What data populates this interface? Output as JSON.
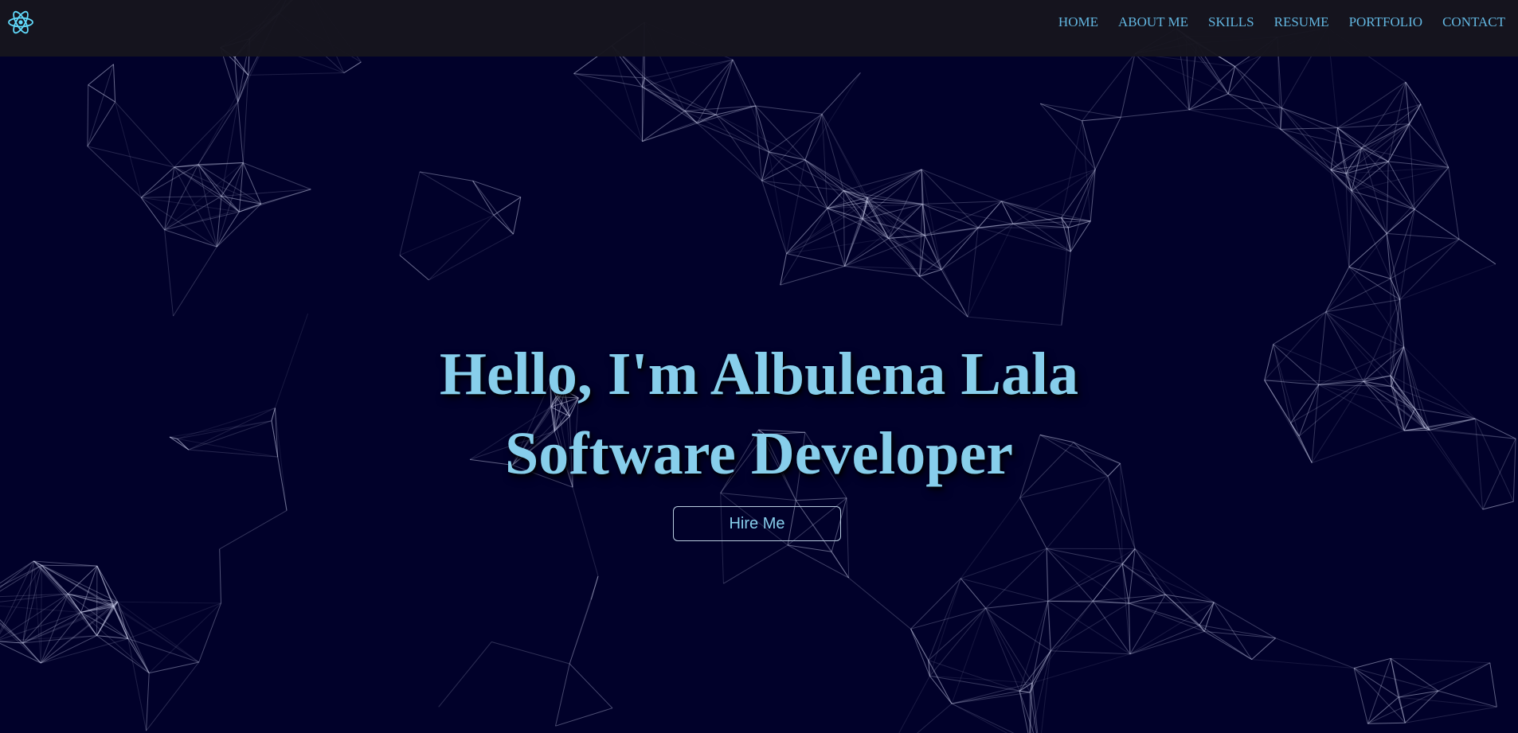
{
  "nav": {
    "logo_icon": "atom-icon",
    "items": [
      {
        "label": "HOME"
      },
      {
        "label": "ABOUT ME"
      },
      {
        "label": "SKILLS"
      },
      {
        "label": "RESUME"
      },
      {
        "label": "PORTFOLIO"
      },
      {
        "label": "CONTACT"
      }
    ]
  },
  "hero": {
    "greeting": "Hello, I'm Albulena Lala",
    "role": "Software Developer",
    "cta_label": "Hire Me"
  },
  "colors": {
    "background": "#01012a",
    "navbar": "#16151e",
    "accent": "#87ceeb",
    "nav_text": "#62b6e0"
  }
}
